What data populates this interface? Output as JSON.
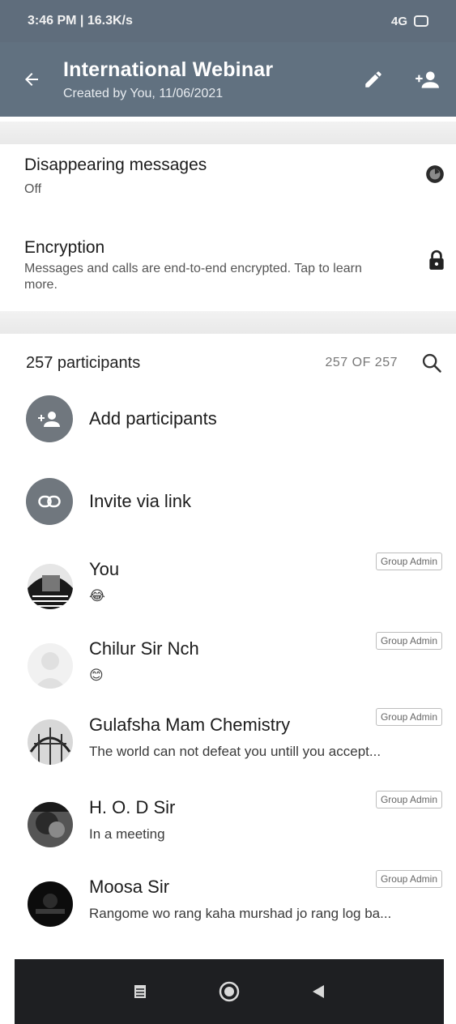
{
  "status_bar": {
    "time_info": "3:46 PM | 16.3K/s",
    "right_info": "4G"
  },
  "header": {
    "title": "International Webinar",
    "subtitle": "Created by You, 11/06/2021",
    "icons": [
      "back-arrow-icon",
      "pencil-icon",
      "add-person-icon"
    ]
  },
  "disappearing": {
    "title": "Disappearing messages",
    "value": "Off"
  },
  "encryption": {
    "title": "Encryption",
    "description": "Messages and calls are end-to-end encrypted. Tap to learn more."
  },
  "participants": {
    "count_label": "257 participants",
    "range_label": "257 OF 257"
  },
  "actions": [
    {
      "label": "Add participants",
      "icon": "add-person-icon"
    },
    {
      "label": "Invite via link",
      "icon": "link-icon"
    }
  ],
  "members": [
    {
      "name": "You",
      "status": "😂",
      "badge": "Group Admin"
    },
    {
      "name": "Chilur Sir Nch",
      "status": "😊",
      "badge": "Group Admin"
    },
    {
      "name": "Gulafsha Mam Chemistry",
      "status": "The world can not defeat you untill you accept...",
      "badge": "Group Admin"
    },
    {
      "name": "H. O. D Sir",
      "status": "In a meeting",
      "badge": "Group Admin"
    },
    {
      "name": "Moosa Sir",
      "status": "Rangome wo rang kaha murshad jo rang log ba...",
      "badge": "Group Admin"
    }
  ],
  "colors": {
    "appbar": "#617180",
    "action_circle": "#70777e",
    "navbar": "#1e1f22"
  }
}
